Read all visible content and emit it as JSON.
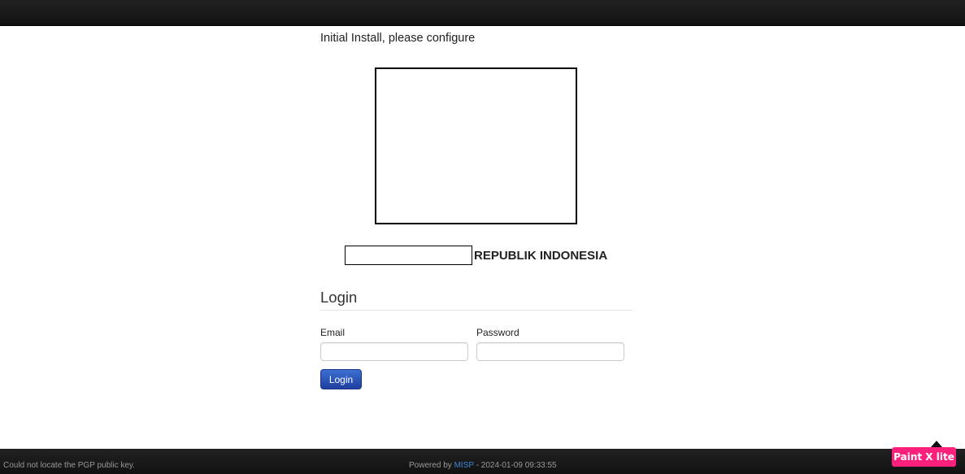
{
  "header": {},
  "intro_text": "Initial Install, please configure",
  "org": {
    "name": "REPUBLIK INDONESIA"
  },
  "login": {
    "title": "Login",
    "email_label": "Email",
    "email_value": "",
    "password_label": "Password",
    "password_value": "",
    "submit_label": "Login"
  },
  "footer": {
    "left_text": "Could not locate the PGP public key.",
    "powered_by": "Powered by",
    "misp_link": "MISP",
    "timestamp": "- 2024-01-09 09:33:55"
  },
  "overlay_badge": "Paint X lite",
  "colors": {
    "bar": "#151515",
    "button": "#2a4fb8",
    "link": "#3a87d6",
    "badge": "#ff1f7d"
  }
}
